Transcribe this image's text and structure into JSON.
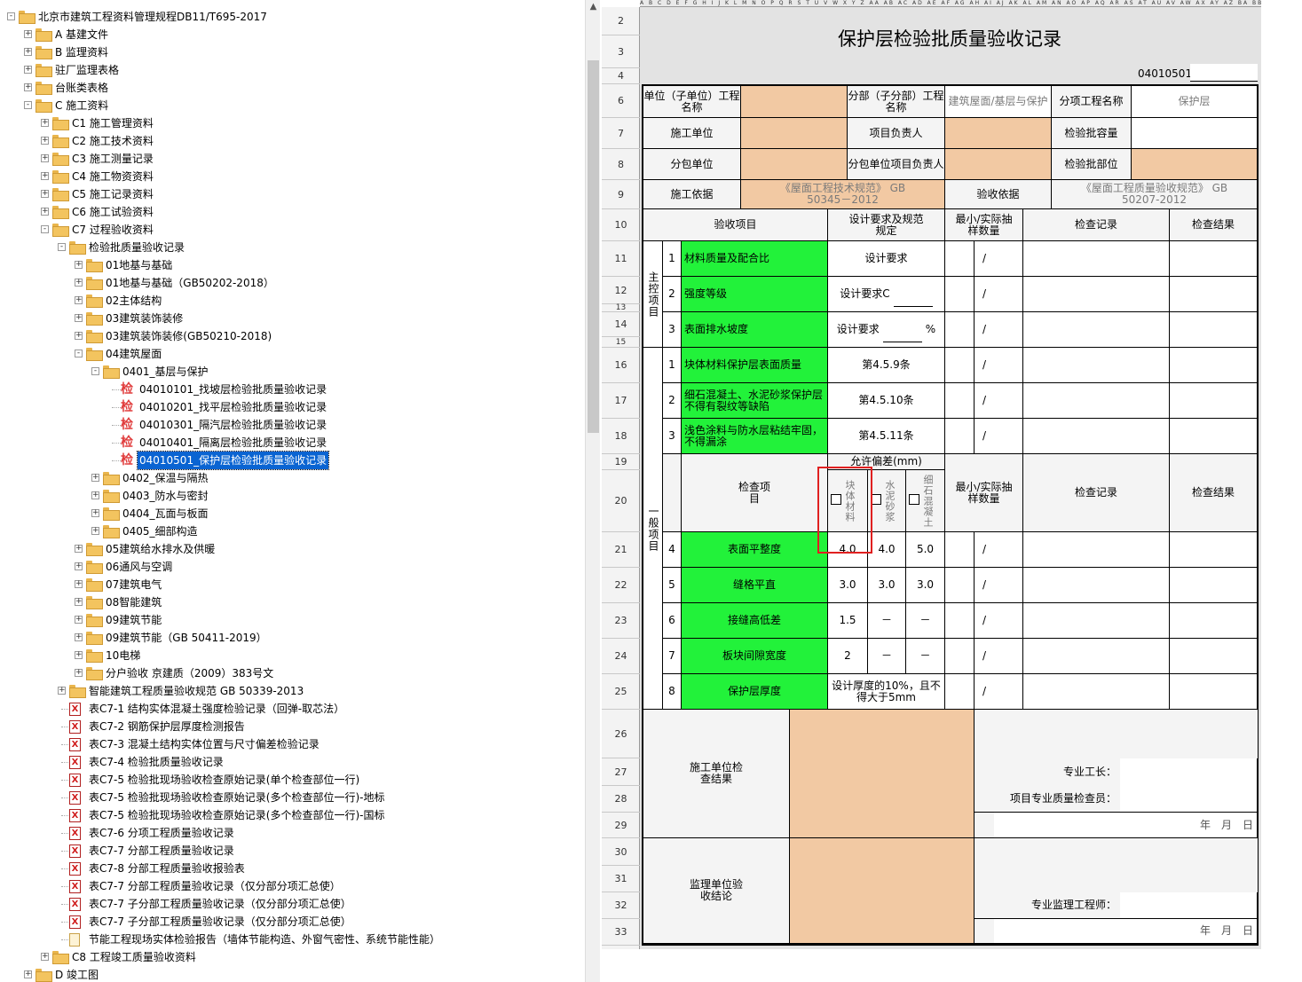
{
  "tree": {
    "nodes": [
      {
        "label": "北京市建筑工程资料管理规程DB11/T695-2017",
        "level": 0,
        "icon": "folder-open-icon",
        "expand": "-"
      },
      {
        "label": "A 基建文件",
        "level": 1,
        "icon": "folder-icon",
        "expand": "+"
      },
      {
        "label": "B 监理资料",
        "level": 1,
        "icon": "folder-icon",
        "expand": "+"
      },
      {
        "label": "驻厂监理表格",
        "level": 1,
        "icon": "folder-icon",
        "expand": "+"
      },
      {
        "label": "台账类表格",
        "level": 1,
        "icon": "folder-icon",
        "expand": "+"
      },
      {
        "label": "C 施工资料",
        "level": 1,
        "icon": "folder-open-icon",
        "expand": "-"
      },
      {
        "label": "C1 施工管理资料",
        "level": 2,
        "icon": "folder-icon",
        "expand": "+"
      },
      {
        "label": "C2 施工技术资料",
        "level": 2,
        "icon": "folder-icon",
        "expand": "+"
      },
      {
        "label": "C3 施工测量记录",
        "level": 2,
        "icon": "folder-icon",
        "expand": "+"
      },
      {
        "label": "C4 施工物资资料",
        "level": 2,
        "icon": "folder-icon",
        "expand": "+"
      },
      {
        "label": "C5 施工记录资料",
        "level": 2,
        "icon": "folder-icon",
        "expand": "+"
      },
      {
        "label": "C6 施工试验资料",
        "level": 2,
        "icon": "folder-icon",
        "expand": "+"
      },
      {
        "label": "C7 过程验收资料",
        "level": 2,
        "icon": "folder-open-icon",
        "expand": "-"
      },
      {
        "label": "检验批质量验收记录",
        "level": 3,
        "icon": "folder-open-icon",
        "expand": "-"
      },
      {
        "label": "01地基与基础",
        "level": 4,
        "icon": "folder-icon",
        "expand": "+"
      },
      {
        "label": "01地基与基础（GB50202-2018）",
        "level": 4,
        "icon": "folder-icon",
        "expand": "+"
      },
      {
        "label": "02主体结构",
        "level": 4,
        "icon": "folder-icon",
        "expand": "+"
      },
      {
        "label": "03建筑装饰装修",
        "level": 4,
        "icon": "folder-icon",
        "expand": "+"
      },
      {
        "label": "03建筑装饰装修(GB50210-2018)",
        "level": 4,
        "icon": "folder-icon",
        "expand": "+"
      },
      {
        "label": "04建筑屋面",
        "level": 4,
        "icon": "folder-open-icon",
        "expand": "-"
      },
      {
        "label": "0401_基层与保护",
        "level": 5,
        "icon": "folder-open-icon",
        "expand": "-"
      },
      {
        "label": "04010101_找坡层检验批质量验收记录",
        "level": 6,
        "icon": "inspection-icon",
        "expand": ""
      },
      {
        "label": "04010201_找平层检验批质量验收记录",
        "level": 6,
        "icon": "inspection-icon",
        "expand": ""
      },
      {
        "label": "04010301_隔汽层检验批质量验收记录",
        "level": 6,
        "icon": "inspection-icon",
        "expand": ""
      },
      {
        "label": "04010401_隔离层检验批质量验收记录",
        "level": 6,
        "icon": "inspection-icon",
        "expand": ""
      },
      {
        "label": "04010501_保护层检验批质量验收记录",
        "level": 6,
        "icon": "inspection-icon",
        "expand": "",
        "selected": true
      },
      {
        "label": "0402_保温与隔热",
        "level": 5,
        "icon": "folder-icon",
        "expand": "+"
      },
      {
        "label": "0403_防水与密封",
        "level": 5,
        "icon": "folder-icon",
        "expand": "+"
      },
      {
        "label": "0404_瓦面与板面",
        "level": 5,
        "icon": "folder-icon",
        "expand": "+"
      },
      {
        "label": "0405_细部构造",
        "level": 5,
        "icon": "folder-icon",
        "expand": "+"
      },
      {
        "label": "05建筑给水排水及供暖",
        "level": 4,
        "icon": "folder-icon",
        "expand": "+"
      },
      {
        "label": "06通风与空调",
        "level": 4,
        "icon": "folder-icon",
        "expand": "+"
      },
      {
        "label": "07建筑电气",
        "level": 4,
        "icon": "folder-icon",
        "expand": "+"
      },
      {
        "label": "08智能建筑",
        "level": 4,
        "icon": "folder-icon",
        "expand": "+"
      },
      {
        "label": "09建筑节能",
        "level": 4,
        "icon": "folder-icon",
        "expand": "+"
      },
      {
        "label": "09建筑节能（GB 50411-2019）",
        "level": 4,
        "icon": "folder-icon",
        "expand": "+"
      },
      {
        "label": "10电梯",
        "level": 4,
        "icon": "folder-icon",
        "expand": "+"
      },
      {
        "label": "分户验收 京建质（2009）383号文",
        "level": 4,
        "icon": "folder-icon",
        "expand": "+"
      },
      {
        "label": "智能建筑工程质量验收规范 GB 50339-2013",
        "level": 3,
        "icon": "folder-icon",
        "expand": "+"
      },
      {
        "label": "表C7-1 结构实体混凝土强度检验记录（回弹-取芯法）",
        "level": 3,
        "icon": "excel-icon",
        "expand": ""
      },
      {
        "label": "表C7-2 钢筋保护层厚度检测报告",
        "level": 3,
        "icon": "excel-icon",
        "expand": ""
      },
      {
        "label": "表C7-3 混凝土结构实体位置与尺寸偏差检验记录",
        "level": 3,
        "icon": "excel-icon",
        "expand": ""
      },
      {
        "label": "表C7-4 检验批质量验收记录",
        "level": 3,
        "icon": "excel-icon",
        "expand": ""
      },
      {
        "label": "表C7-5 检验批现场验收检查原始记录(单个检查部位一行)",
        "level": 3,
        "icon": "excel-icon",
        "expand": ""
      },
      {
        "label": "表C7-5 检验批现场验收检查原始记录(多个检查部位一行)-地标",
        "level": 3,
        "icon": "excel-icon",
        "expand": ""
      },
      {
        "label": "表C7-5 检验批现场验收检查原始记录(多个检查部位一行)-国标",
        "level": 3,
        "icon": "excel-icon",
        "expand": ""
      },
      {
        "label": "表C7-6 分项工程质量验收记录",
        "level": 3,
        "icon": "excel-icon",
        "expand": ""
      },
      {
        "label": "表C7-7 分部工程质量验收记录",
        "level": 3,
        "icon": "excel-icon",
        "expand": ""
      },
      {
        "label": "表C7-8 分部工程质量验收报验表",
        "level": 3,
        "icon": "excel-icon",
        "expand": ""
      },
      {
        "label": "表C7-7 分部工程质量验收记录（仅分部分项汇总使）",
        "level": 3,
        "icon": "excel-icon",
        "expand": ""
      },
      {
        "label": "表C7-7 子分部工程质量验收记录（仅分部分项汇总使）",
        "level": 3,
        "icon": "excel-icon",
        "expand": ""
      },
      {
        "label": "表C7-7 子分部工程质量验收记录（仅分部分项汇总使）",
        "level": 3,
        "icon": "excel-icon",
        "expand": ""
      },
      {
        "label": "节能工程现场实体检验报告（墙体节能构造、外窗气密性、系统节能性能）",
        "level": 3,
        "icon": "doc-icon",
        "expand": ""
      },
      {
        "label": "C8 工程竣工质量验收资料",
        "level": 2,
        "icon": "folder-icon",
        "expand": "+"
      },
      {
        "label": "D 竣工图",
        "level": 1,
        "icon": "folder-icon",
        "expand": "+"
      }
    ]
  },
  "sheet": {
    "col_header": "A B C D E F G H I J K L M N O P Q R S T U V W X Y Z AA AB AC AD AE AF AG AH AI AJ AK AL AM AN AO AP AQ AR AS AT AU AV AW AX AY AZ BA BB BC BD BE BF BG",
    "row_numbers": [
      "2",
      "3",
      "4",
      "6",
      "7",
      "8",
      "9",
      "10",
      "11",
      "12",
      "13",
      "14",
      "15",
      "16",
      "17",
      "18",
      "19",
      "20",
      "21",
      "22",
      "23",
      "24",
      "25",
      "26",
      "27",
      "28",
      "29",
      "30",
      "31",
      "32",
      "33"
    ],
    "title": "保护层检验批质量验收记录",
    "code": "04010501",
    "form": {
      "unit_label": "单位（子单位）工程名称",
      "sub_label": "分部（子分部）工程名称",
      "sub_value": "建筑屋面/基层与保护",
      "item_label": "分项工程名称",
      "item_value": "保护层",
      "constructor_label": "施工单位",
      "pm_label": "项目负责人",
      "capacity_label": "检验批容量",
      "subcontractor_label": "分包单位",
      "sub_pm_label": "分包单位项目负责人",
      "location_label": "检验批部位",
      "basis_label": "施工依据",
      "basis_value": "《屋面工程技术规范》 GB 50345－2012",
      "acc_basis_label": "验收依据",
      "acc_basis_value": "《屋面工程质量验收规范》 GB 50207-2012",
      "h_item": "验收项目",
      "h_design": "设计要求及规范规定",
      "h_sample": "最小/实际抽样数量",
      "h_record": "检查记录",
      "h_result": "检查结果",
      "main_label": "主控项目",
      "general_label": "一般项目",
      "main_items": [
        {
          "n": "1",
          "name": "材料质量及配合比",
          "req": "设计要求"
        },
        {
          "n": "2",
          "name": "强度等级",
          "req": "设计要求C"
        },
        {
          "n": "3",
          "name": "表面排水坡度",
          "req": "设计要求",
          "unit": "%"
        }
      ],
      "gen_items": [
        {
          "n": "1",
          "name": "块体材料保护层表面质量",
          "req": "第4.5.9条"
        },
        {
          "n": "2",
          "name": "细石混凝土、水泥砂浆保护层不得有裂纹等缺陷",
          "req": "第4.5.10条"
        },
        {
          "n": "3",
          "name": "浅色涂料与防水层粘结牢固，不得漏涂",
          "req": "第4.5.11条"
        }
      ],
      "slash": "/",
      "tol_title": "允许偏差(mm)",
      "check_item": "检查项目",
      "tol_cols": [
        "块体材料",
        "水泥砂浆",
        "细石混凝土"
      ],
      "tol_items": [
        {
          "n": "4",
          "name": "表面平整度",
          "v": [
            "4.0",
            "4.0",
            "5.0"
          ]
        },
        {
          "n": "5",
          "name": "缝格平直",
          "v": [
            "3.0",
            "3.0",
            "3.0"
          ]
        },
        {
          "n": "6",
          "name": "接缝高低差",
          "v": [
            "1.5",
            "－",
            "－"
          ]
        },
        {
          "n": "7",
          "name": "板块间隙宽度",
          "v": [
            "2",
            "－",
            "－"
          ]
        },
        {
          "n": "8",
          "name": "保护层厚度",
          "merged": "设计厚度的10%，且不得大于5mm"
        }
      ],
      "constr_result": "施工单位检查结果",
      "foreman": "专业工长：",
      "qc_inspector": "项目专业质量检查员：",
      "date": "年　月　日",
      "supervision": "监理单位验收结论",
      "engineer": "专业监理工程师："
    }
  },
  "colors": {
    "peach": "#f2c9a3",
    "green": "#22f23a",
    "selection": "#0a64d2",
    "highlight": "#e02020"
  }
}
